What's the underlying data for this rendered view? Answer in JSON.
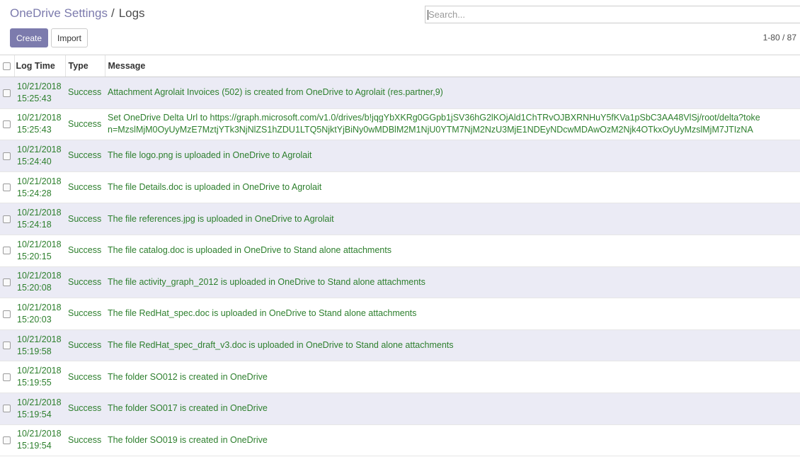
{
  "breadcrumb": {
    "parent": "OneDrive Settings",
    "separator": "/",
    "current": "Logs"
  },
  "search": {
    "placeholder": "Search..."
  },
  "toolbar": {
    "create_label": "Create",
    "import_label": "Import"
  },
  "pager": {
    "text": "1-80 / 87"
  },
  "colors": {
    "accent": "#7c7bad",
    "success_text": "#2d7f2d",
    "row_stripe": "#ebebf5"
  },
  "table": {
    "headers": {
      "time": "Log Time",
      "type": "Type",
      "message": "Message"
    },
    "rows": [
      {
        "date": "10/21/2018",
        "time": "15:25:43",
        "type": "Success",
        "message": "Attachment Agrolait Invoices (502) is created from OneDrive to Agrolait (res.partner,9)"
      },
      {
        "date": "10/21/2018",
        "time": "15:25:43",
        "type": "Success",
        "message": "Set OneDrive Delta Url to https://graph.microsoft.com/v1.0/drives/b!jqgYbXKRg0GGpb1jSV36hG2lKOjAld1ChTRvOJBXRNHuY5fKVa1pSbC3AA48VlSj/root/delta?token=MzslMjM0OyUyMzE7MztjYTk3NjNlZS1hZDU1LTQ5NjktYjBiNy0wMDBlM2M1NjU0YTM7NjM2NzU3MjE1NDEyNDcwMDAwOzM2Njk4OTkxOyUyMzslMjM7JTIzNA"
      },
      {
        "date": "10/21/2018",
        "time": "15:24:40",
        "type": "Success",
        "message": "The file logo.png is uploaded in OneDrive to Agrolait"
      },
      {
        "date": "10/21/2018",
        "time": "15:24:28",
        "type": "Success",
        "message": "The file Details.doc is uploaded in OneDrive to Agrolait"
      },
      {
        "date": "10/21/2018",
        "time": "15:24:18",
        "type": "Success",
        "message": "The file references.jpg is uploaded in OneDrive to Agrolait"
      },
      {
        "date": "10/21/2018",
        "time": "15:20:15",
        "type": "Success",
        "message": "The file catalog.doc is uploaded in OneDrive to Stand alone attachments"
      },
      {
        "date": "10/21/2018",
        "time": "15:20:08",
        "type": "Success",
        "message": "The file activity_graph_2012 is uploaded in OneDrive to Stand alone attachments"
      },
      {
        "date": "10/21/2018",
        "time": "15:20:03",
        "type": "Success",
        "message": "The file RedHat_spec.doc is uploaded in OneDrive to Stand alone attachments"
      },
      {
        "date": "10/21/2018",
        "time": "15:19:58",
        "type": "Success",
        "message": "The file RedHat_spec_draft_v3.doc is uploaded in OneDrive to Stand alone attachments"
      },
      {
        "date": "10/21/2018",
        "time": "15:19:55",
        "type": "Success",
        "message": "The folder SO012 is created in OneDrive"
      },
      {
        "date": "10/21/2018",
        "time": "15:19:54",
        "type": "Success",
        "message": "The folder SO017 is created in OneDrive"
      },
      {
        "date": "10/21/2018",
        "time": "15:19:54",
        "type": "Success",
        "message": "The folder SO019 is created in OneDrive"
      }
    ]
  }
}
